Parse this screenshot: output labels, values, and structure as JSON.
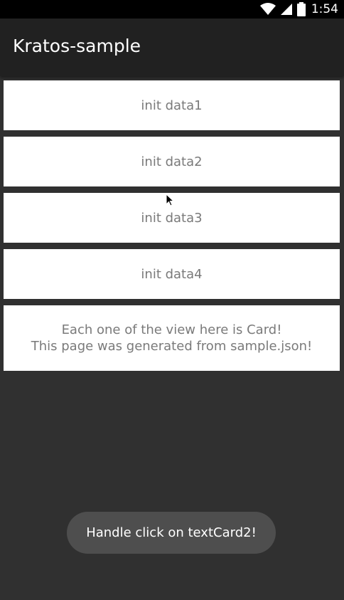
{
  "status_bar": {
    "time": "1:54",
    "icons": [
      "wifi-icon",
      "cell-signal-icon",
      "battery-icon"
    ]
  },
  "app_bar": {
    "title": "Kratos-sample"
  },
  "cards": [
    {
      "label": "init data1"
    },
    {
      "label": "init data2"
    },
    {
      "label": "init data3"
    },
    {
      "label": "init data4"
    }
  ],
  "info_card": {
    "line1": "Each one of the view here is Card!",
    "line2": "This page was generated from sample.json!"
  },
  "toast": {
    "message": "Handle click on textCard2!"
  },
  "colors": {
    "background": "#303030",
    "app_bar": "#212121",
    "card": "#ffffff",
    "card_text": "#7a7a7a",
    "toast": "#4e4e4e"
  }
}
